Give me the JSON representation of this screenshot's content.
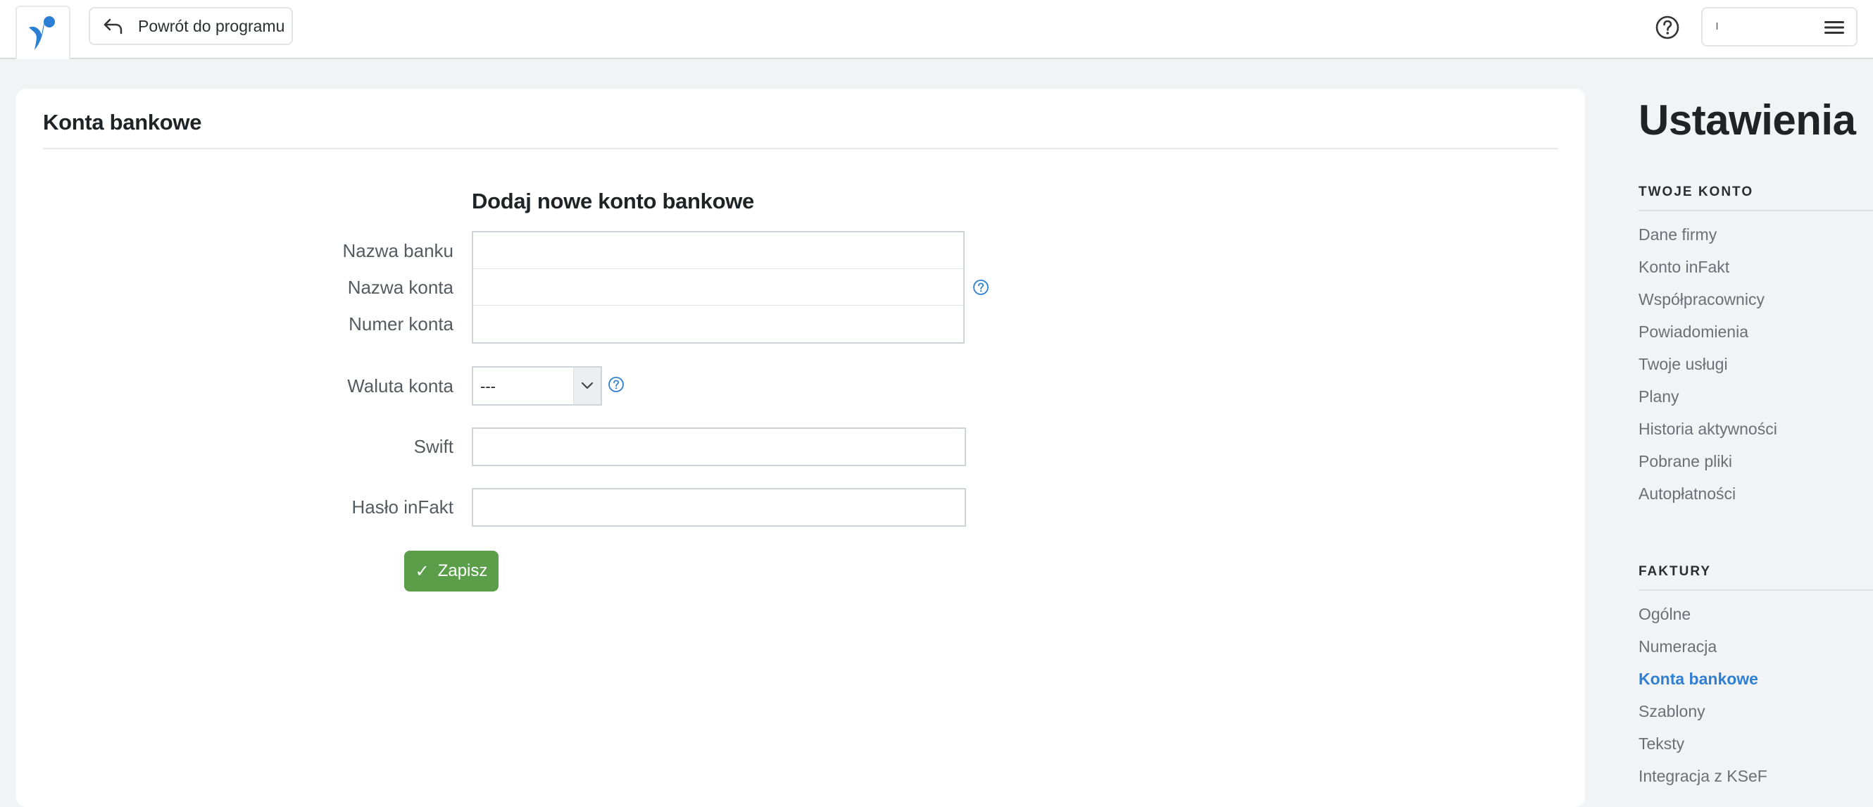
{
  "topbar": {
    "back_label": "Powrót do programu",
    "user_name": "ı",
    "icons": {
      "logo": "infakt-logo",
      "back": "back-arrow-icon",
      "help": "help-circle-icon",
      "menu": "hamburger-icon"
    }
  },
  "main": {
    "title": "Konta bankowe",
    "form": {
      "heading": "Dodaj nowe konto bankowe",
      "fields": {
        "bank_name": {
          "label": "Nazwa banku",
          "value": ""
        },
        "account_name": {
          "label": "Nazwa konta",
          "value": ""
        },
        "account_number": {
          "label": "Numer konta",
          "value": ""
        },
        "currency": {
          "label": "Waluta konta",
          "value": "---"
        },
        "swift": {
          "label": "Swift",
          "value": ""
        },
        "password": {
          "label": "Hasło inFakt",
          "value": ""
        }
      },
      "save_label": "Zapisz"
    }
  },
  "sidebar": {
    "title": "Ustawienia",
    "sections": [
      {
        "heading": "TWOJE KONTO",
        "items": [
          "Dane firmy",
          "Konto inFakt",
          "Współpracownicy",
          "Powiadomienia",
          "Twoje usługi",
          "Plany",
          "Historia aktywności",
          "Pobrane pliki",
          "Autopłatności"
        ]
      },
      {
        "heading": "FAKTURY",
        "items": [
          "Ogólne",
          "Numeracja",
          "Konta bankowe",
          "Szablony",
          "Teksty",
          "Integracja z KSeF"
        ],
        "active_item": "Konta bankowe"
      }
    ]
  },
  "colors": {
    "accent_blue": "#2f7fd3",
    "save_green": "#5a9e49",
    "logo_blue": "#2b7fd4",
    "background": "#f2f3f4"
  }
}
